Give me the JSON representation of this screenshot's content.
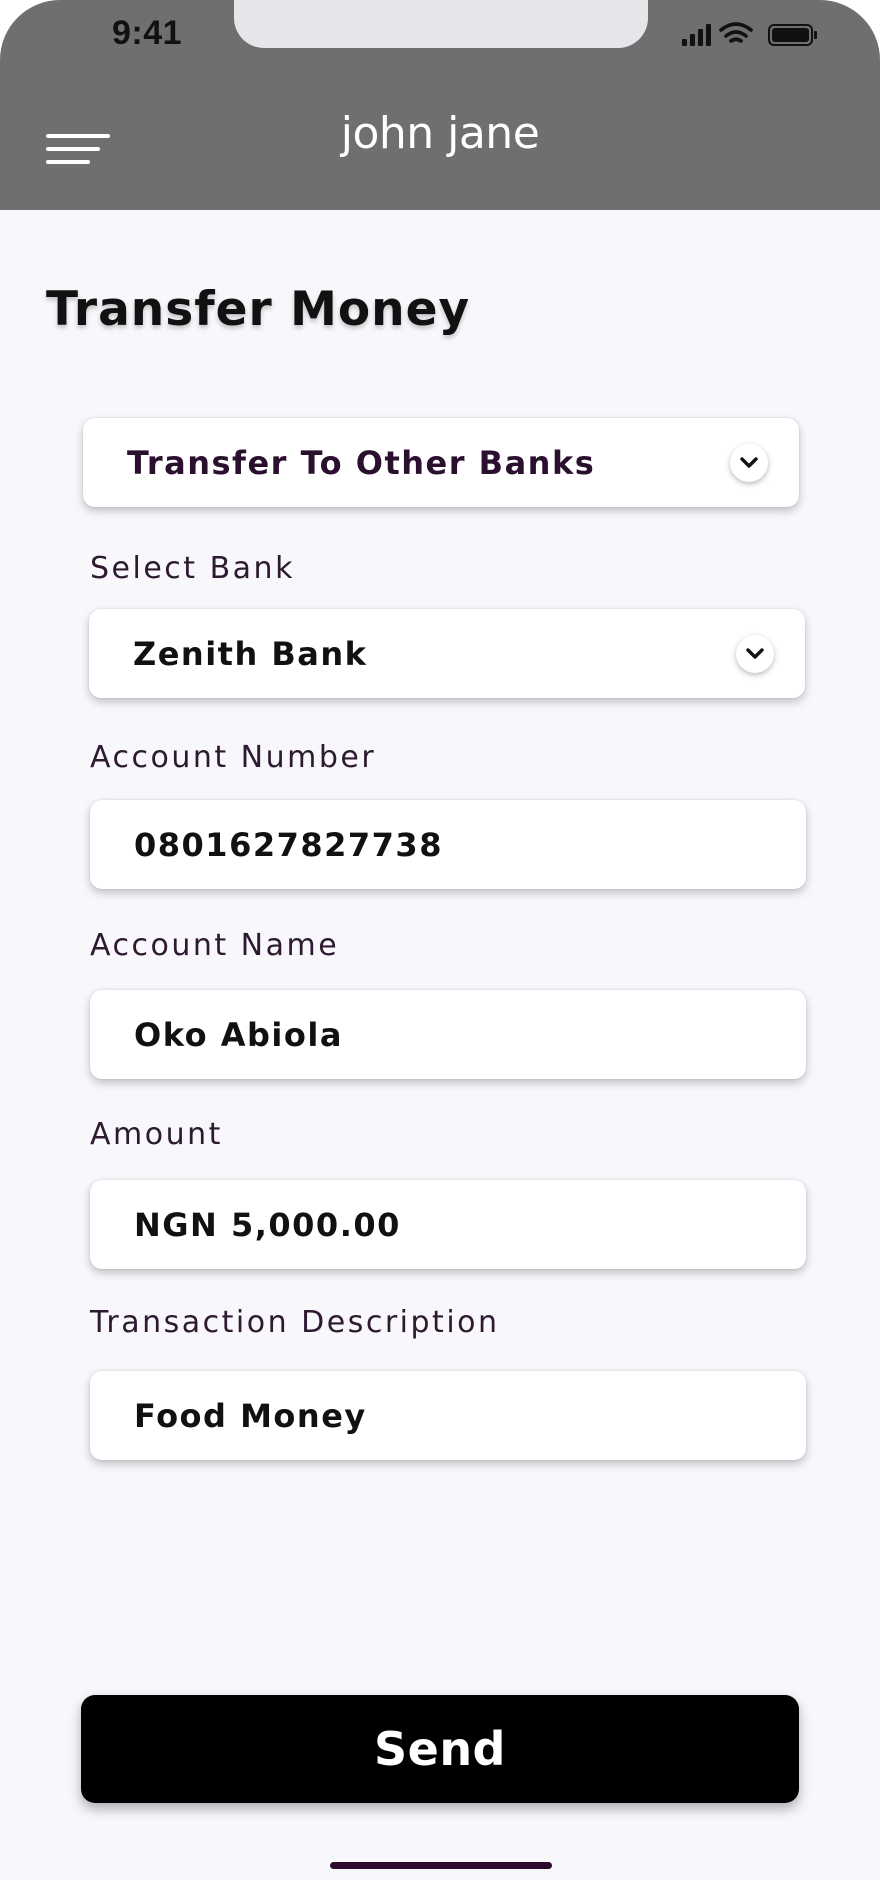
{
  "status_bar": {
    "time": "9:41",
    "signal_icon": "cellular-signal-icon",
    "wifi_icon": "wifi-icon",
    "battery_icon": "battery-icon"
  },
  "header": {
    "menu_icon": "hamburger-menu-icon",
    "title": "john jane",
    "background_color": "#6f6f6f"
  },
  "page": {
    "title": "Transfer Money"
  },
  "form": {
    "transfer_type": {
      "value": "Transfer To Other Banks",
      "icon": "chevron-down-icon"
    },
    "bank": {
      "label": "Select Bank",
      "value": "Zenith Bank",
      "icon": "chevron-down-icon"
    },
    "account_number": {
      "label": "Account Number",
      "value": "0801627827738"
    },
    "account_name": {
      "label": "Account Name",
      "value": "Oko Abiola"
    },
    "amount": {
      "label": "Amount",
      "value": "NGN 5,000.00"
    },
    "description": {
      "label": "Transaction Description",
      "value": "Food Money"
    }
  },
  "actions": {
    "send_label": "Send"
  },
  "colors": {
    "page_background": "#f8f7fc",
    "label_text": "#2d1a30",
    "button_background": "#000000",
    "home_indicator": "#2b0a2e"
  }
}
